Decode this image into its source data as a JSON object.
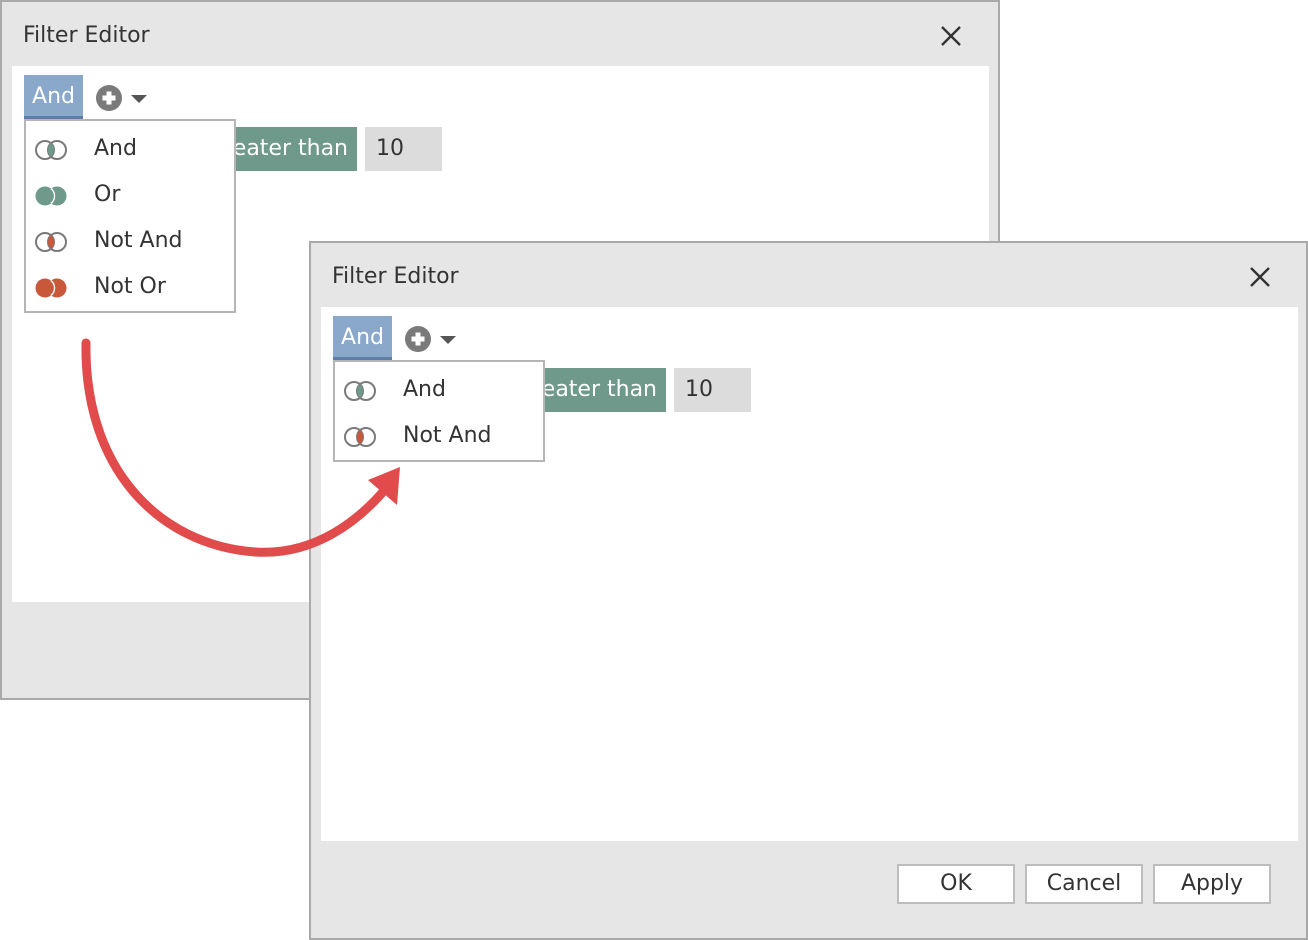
{
  "dialog_before": {
    "title": "Filter Editor",
    "group_operator": "And",
    "condition": {
      "operator_visible_text": "reater than",
      "value": "10"
    },
    "dropdown_items": [
      {
        "label": "And",
        "icon": "and-icon"
      },
      {
        "label": "Or",
        "icon": "or-icon"
      },
      {
        "label": "Not And",
        "icon": "not-and-icon"
      },
      {
        "label": "Not Or",
        "icon": "not-or-icon"
      }
    ]
  },
  "dialog_after": {
    "title": "Filter Editor",
    "group_operator": "And",
    "condition": {
      "operator_visible_text": "reater than",
      "value": "10"
    },
    "dropdown_items": [
      {
        "label": "And",
        "icon": "and-icon"
      },
      {
        "label": "Not And",
        "icon": "not-and-icon"
      }
    ],
    "buttons": {
      "ok": "OK",
      "cancel": "Cancel",
      "apply": "Apply"
    }
  },
  "colors": {
    "dialog_bg": "#e6e6e6",
    "group_operator_bg": "#8aa8c9",
    "operator_chip_bg": "#6f9a8b",
    "value_chip_bg": "#dcdcdc",
    "and_accent": "#6f9a8b",
    "not_accent": "#c9573a",
    "arrow": "#e24b4b"
  }
}
